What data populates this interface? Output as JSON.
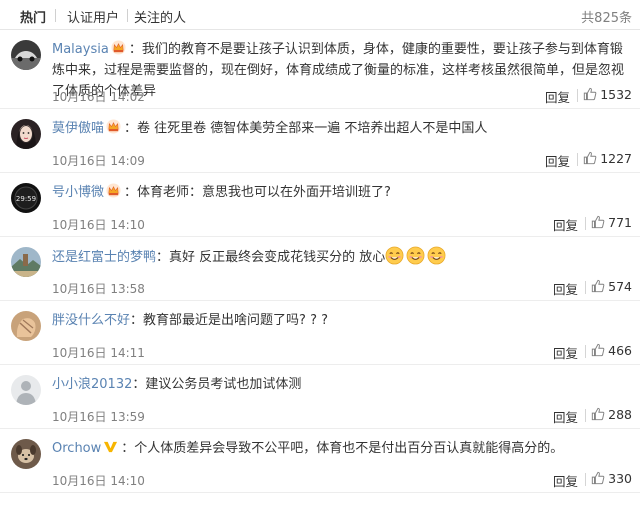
{
  "tabs": [
    {
      "label": "热门",
      "active": true
    },
    {
      "label": "认证用户",
      "active": false
    },
    {
      "label": "关注的人",
      "active": false
    }
  ],
  "total_count": "共825条",
  "accent_colors": {
    "username": "#5a83b2",
    "meta": "#808080",
    "crown": "#f5a623",
    "vip": "#f7b500"
  },
  "reply_label": "回复",
  "comments": [
    {
      "user": "Malaysia",
      "badge": "crown-icon",
      "separator": "：",
      "text": "我们的教育不是要让孩子认识到体质，身体，健康的重要性，要让孩子参与到体育锻炼中来，过程是需要监督的，现在倒好，体育成绩成了衡量的标准，这样考核虽然很简单，但是忽视了体质的个体差异",
      "time": "10月16日 14:02",
      "likes": "1532",
      "avatar": "car-avatar"
    },
    {
      "user": "莫伊傲喵",
      "badge": "crown-icon",
      "separator": "：",
      "text": "卷 往死里卷 德智体美劳全部来一遍 不培养出超人不是中国人",
      "time": "10月16日 14:09",
      "likes": "1227",
      "avatar": "girl-avatar"
    },
    {
      "user": "号小博微",
      "badge": "crown-icon",
      "separator": "：",
      "text": "体育老师：意思我也可以在外面开培训班了?",
      "time": "10月16日 14:10",
      "likes": "771",
      "avatar": "clock-avatar"
    },
    {
      "user": "还是红富士的梦鸭",
      "badge": "",
      "separator": "：",
      "text": "真好 反正最终会变成花钱买分的 放心",
      "emojis": [
        "smile-emoji",
        "smile-emoji",
        "smile-emoji"
      ],
      "time": "10月16日 13:58",
      "likes": "574",
      "avatar": "landscape-avatar"
    },
    {
      "user": "胖没什么不好",
      "badge": "",
      "separator": "：",
      "text": "教育部最近是出啥问题了吗? ? ?",
      "time": "10月16日 14:11",
      "likes": "466",
      "avatar": "hand-avatar"
    },
    {
      "user": "小小浪20132",
      "badge": "",
      "separator": "：",
      "text": "建议公务员考试也加试体测",
      "time": "10月16日 13:59",
      "likes": "288",
      "avatar": "person-avatar"
    },
    {
      "user": "Orchow",
      "badge": "vip-icon",
      "separator": "：",
      "text": "个人体质差异会导致不公平吧，体育也不是付出百分百认真就能得高分的。",
      "time": "10月16日 14:10",
      "likes": "330",
      "avatar": "dog-avatar"
    }
  ]
}
